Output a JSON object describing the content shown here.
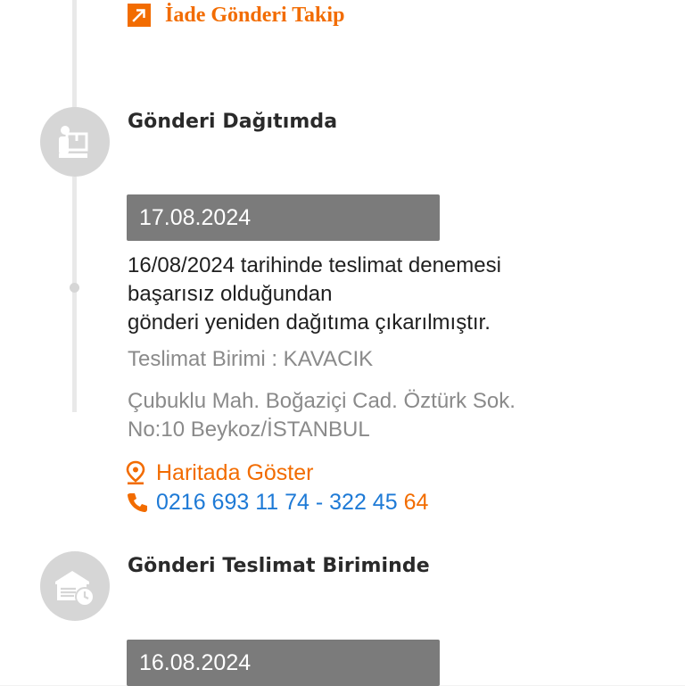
{
  "return_tracking": {
    "label": "İade Gönderi Takip",
    "icon": "external-arrow-icon",
    "color": "#f26c00"
  },
  "steps": [
    {
      "title": "Gönderi Dağıtımda",
      "icon": "courier-package-icon",
      "date": "17.08.2024",
      "description_lines": [
        "16/08/2024 tarihinde teslimat denemesi",
        "başarısız olduğundan",
        "gönderi yeniden dağıtıma çıkarılmıştır."
      ],
      "unit": "Teslimat Birimi : KAVACIK",
      "address_lines": [
        "Çubuklu Mah. Boğaziçi Cad. Öztürk Sok.",
        "No:10 Beykoz/İSTANBUL"
      ],
      "map_label": "Haritada Göster",
      "phone_main": "0216 693 11 74 - 322 45 ",
      "phone_tail": "64"
    },
    {
      "title": "Gönderi Teslimat Biriminde",
      "icon": "branch-clock-icon",
      "date": "16.08.2024"
    }
  ],
  "colors": {
    "accent_orange": "#f26c00",
    "link_blue": "#1e7ad6",
    "date_bar_gray": "#7b7b7b",
    "timeline_gray": "#d6d6d6"
  }
}
